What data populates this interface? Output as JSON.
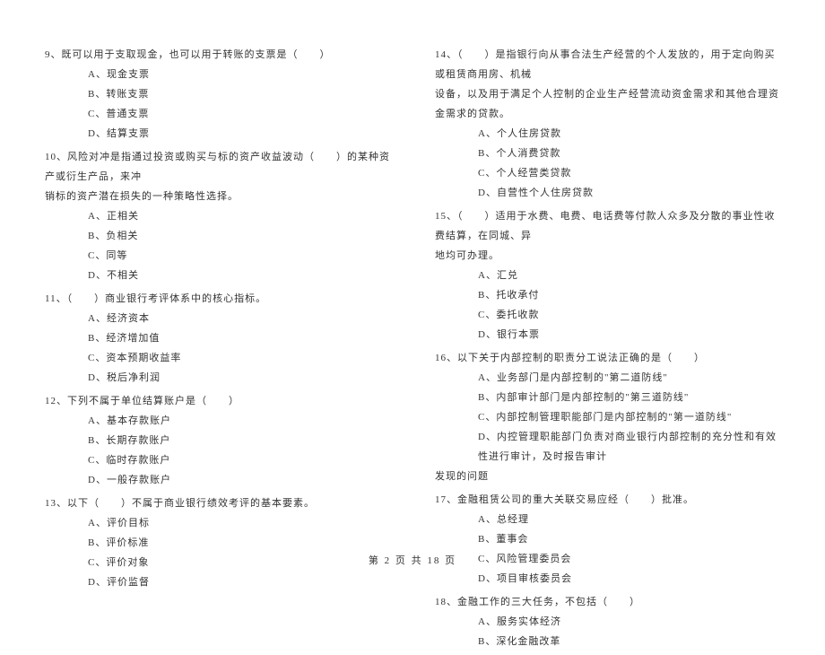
{
  "footer": "第 2 页 共 18 页",
  "left": {
    "q9": {
      "stem": "9、既可以用于支取现金，也可以用于转账的支票是（　　）",
      "opts": [
        "A、现金支票",
        "B、转账支票",
        "C、普通支票",
        "D、结算支票"
      ]
    },
    "q10": {
      "stem1": "10、风险对冲是指通过投资或购买与标的资产收益波动（　　）的某种资产或衍生产品，来冲",
      "stem2": "销标的资产潜在损失的一种策略性选择。",
      "opts": [
        "A、正相关",
        "B、负相关",
        "C、同等",
        "D、不相关"
      ]
    },
    "q11": {
      "stem": "11、（　　）商业银行考评体系中的核心指标。",
      "opts": [
        "A、经济资本",
        "B、经济增加值",
        "C、资本预期收益率",
        "D、税后净利润"
      ]
    },
    "q12": {
      "stem": "12、下列不属于单位结算账户是（　　）",
      "opts": [
        "A、基本存款账户",
        "B、长期存款账户",
        "C、临时存款账户",
        "D、一般存款账户"
      ]
    },
    "q13": {
      "stem": "13、以下（　　）不属于商业银行绩效考评的基本要素。",
      "opts": [
        "A、评价目标",
        "B、评价标准",
        "C、评价对象",
        "D、评价监督"
      ]
    }
  },
  "right": {
    "q14": {
      "stem1": "14、（　　）是指银行向从事合法生产经营的个人发放的，用于定向购买或租赁商用房、机械",
      "stem2": "设备，以及用于满足个人控制的企业生产经营流动资金需求和其他合理资金需求的贷款。",
      "opts": [
        "A、个人住房贷款",
        "B、个人消费贷款",
        "C、个人经营类贷款",
        "D、自营性个人住房贷款"
      ]
    },
    "q15": {
      "stem1": "15、（　　）适用于水费、电费、电话费等付款人众多及分散的事业性收费结算，在同城、异",
      "stem2": "地均可办理。",
      "opts": [
        "A、汇兑",
        "B、托收承付",
        "C、委托收款",
        "D、银行本票"
      ]
    },
    "q16": {
      "stem": "16、以下关于内部控制的职责分工说法正确的是（　　）",
      "opts": [
        "A、业务部门是内部控制的\"第二道防线\"",
        "B、内部审计部门是内部控制的\"第三道防线\"",
        "C、内部控制管理职能部门是内部控制的\"第一道防线\"",
        "D、内控管理职能部门负责对商业银行内部控制的充分性和有效性进行审计，及时报告审计"
      ],
      "cont": "发现的问题"
    },
    "q17": {
      "stem": "17、金融租赁公司的重大关联交易应经（　　）批准。",
      "opts": [
        "A、总经理",
        "B、董事会",
        "C、风险管理委员会",
        "D、项目审核委员会"
      ]
    },
    "q18": {
      "stem": "18、金融工作的三大任务，不包括（　　）",
      "opts": [
        "A、服务实体经济",
        "B、深化金融改革"
      ]
    }
  }
}
